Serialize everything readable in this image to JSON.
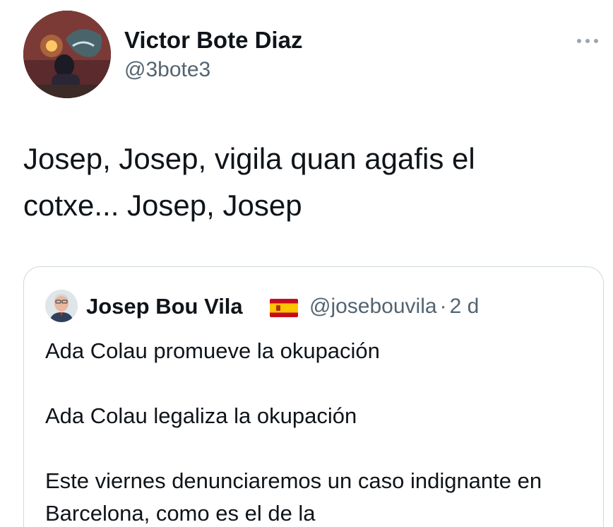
{
  "author": {
    "display_name": "Victor Bote Diaz",
    "handle": "@3bote3",
    "avatar_icon": "profile-photo"
  },
  "more_icon": "more-horizontal-icon",
  "tweet": {
    "text": "Josep, Josep, vigila quan agafis el\ncotxe... Josep, Josep"
  },
  "quoted": {
    "display_name": "Josep Bou Vila",
    "flag_icon": "spain-flag-icon",
    "handle": "@josebouvila",
    "separator": "·",
    "time": "2 d",
    "paragraphs": [
      "Ada Colau promueve la okupación",
      "Ada Colau legaliza la okupación",
      "Este viernes denunciaremos un caso indignante en Barcelona, como es el de la"
    ]
  },
  "colors": {
    "text_primary": "#0f1419",
    "text_secondary": "#536471",
    "border": "#cfd9de"
  }
}
